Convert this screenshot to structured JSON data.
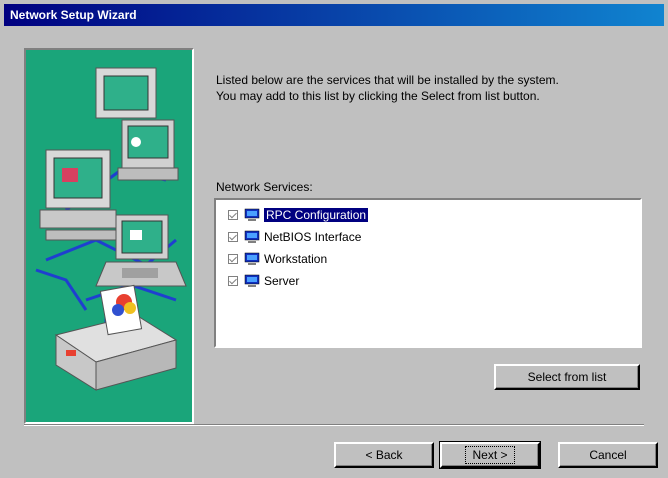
{
  "window": {
    "title": "Network Setup Wizard"
  },
  "intro": {
    "line1": "Listed below are the services that will be installed by the system.",
    "line2": "You may add to this list by clicking the Select from list button."
  },
  "services": {
    "label": "Network Services:",
    "items": [
      {
        "label": "RPC Configuration",
        "checked": true,
        "selected": true
      },
      {
        "label": "NetBIOS Interface",
        "checked": true,
        "selected": false
      },
      {
        "label": "Workstation",
        "checked": true,
        "selected": false
      },
      {
        "label": "Server",
        "checked": true,
        "selected": false
      }
    ]
  },
  "buttons": {
    "select_from_list": "Select from list",
    "back": "< Back",
    "next": "Next >",
    "cancel": "Cancel"
  },
  "colors": {
    "title_bar": "#000080",
    "sidebar": "#1aa57a",
    "selection": "#000080"
  }
}
